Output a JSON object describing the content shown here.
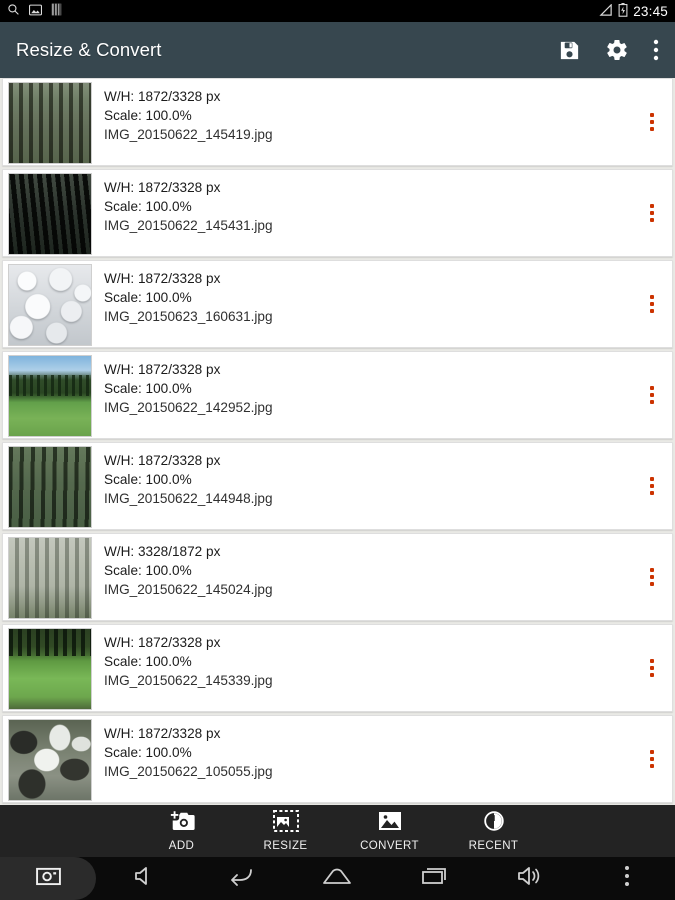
{
  "statusbar": {
    "time": "23:45",
    "left_icons": [
      "search-icon",
      "screenshot-icon",
      "storage-icon"
    ],
    "right_icons": [
      "signal-icon",
      "battery-charging-icon"
    ]
  },
  "appbar": {
    "title": "Resize & Convert",
    "background": "#37474f",
    "actions": [
      {
        "name": "save-button",
        "icon": "floppy-disk-icon"
      },
      {
        "name": "settings-button",
        "icon": "gear-icon"
      },
      {
        "name": "overflow-button",
        "icon": "more-vertical-icon"
      }
    ]
  },
  "list": {
    "labels": {
      "wh_prefix": "W/H:",
      "wh_suffix": "px",
      "scale_prefix": "Scale:"
    },
    "row_menu_color": "#cc3300",
    "items": [
      {
        "dimensions": "W/H: 1872/3328 px",
        "scale": "Scale: 100.0%",
        "filename": "IMG_20150622_145419.jpg",
        "thumb": "t-forest1"
      },
      {
        "dimensions": "W/H: 1872/3328 px",
        "scale": "Scale: 100.0%",
        "filename": "IMG_20150622_145431.jpg",
        "thumb": "t-dark"
      },
      {
        "dimensions": "W/H: 1872/3328 px",
        "scale": "Scale: 100.0%",
        "filename": "IMG_20150623_160631.jpg",
        "thumb": "t-rocks"
      },
      {
        "dimensions": "W/H: 1872/3328 px",
        "scale": "Scale: 100.0%",
        "filename": "IMG_20150622_142952.jpg",
        "thumb": "t-meadow"
      },
      {
        "dimensions": "W/H: 1872/3328 px",
        "scale": "Scale: 100.0%",
        "filename": "IMG_20150622_144948.jpg",
        "thumb": "t-forest2"
      },
      {
        "dimensions": "W/H: 3328/1872 px",
        "scale": "Scale: 100.0%",
        "filename": "IMG_20150622_145024.jpg",
        "thumb": "t-birch"
      },
      {
        "dimensions": "W/H: 1872/3328 px",
        "scale": "Scale: 100.0%",
        "filename": "IMG_20150622_145339.jpg",
        "thumb": "t-glade"
      },
      {
        "dimensions": "W/H: 1872/3328 px",
        "scale": "Scale: 100.0%",
        "filename": "IMG_20150622_105055.jpg",
        "thumb": "t-stream"
      }
    ]
  },
  "actionbar": {
    "actions": [
      {
        "label": "ADD",
        "icon": "add-photo-icon"
      },
      {
        "label": "RESIZE",
        "icon": "crop-resize-icon"
      },
      {
        "label": "CONVERT",
        "icon": "image-convert-icon"
      },
      {
        "label": "RECENT",
        "icon": "recent-clock-icon"
      }
    ]
  },
  "navbar": {
    "buttons": [
      {
        "name": "screenshot-button",
        "icon": "camera-icon",
        "highlighted": true
      },
      {
        "name": "volume-down-button",
        "icon": "volume-down-icon",
        "highlighted": false
      },
      {
        "name": "back-button",
        "icon": "back-arrow-icon",
        "highlighted": false
      },
      {
        "name": "home-button",
        "icon": "home-icon",
        "highlighted": false
      },
      {
        "name": "recents-button",
        "icon": "recents-icon",
        "highlighted": false
      },
      {
        "name": "volume-up-button",
        "icon": "volume-up-icon",
        "highlighted": false
      },
      {
        "name": "nav-overflow-button",
        "icon": "more-vertical-icon",
        "highlighted": false
      }
    ]
  }
}
